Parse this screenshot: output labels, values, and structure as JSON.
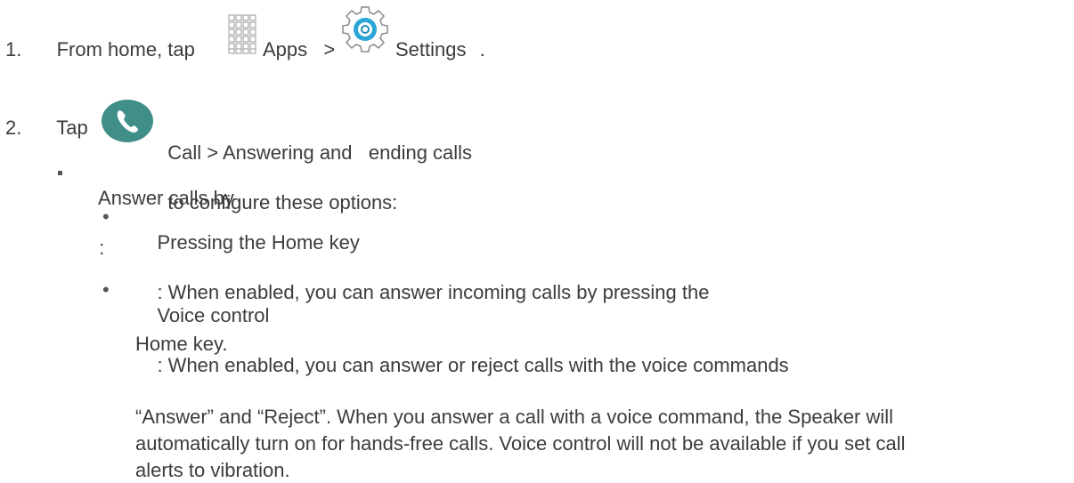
{
  "step1": {
    "number": "1.",
    "lead": "From home, tap",
    "apps_label": "Apps",
    "sep": ">",
    "settings_label": "Settings",
    "end": "."
  },
  "step2": {
    "number": "2.",
    "lead": "Tap",
    "path": "Call > Answering and   ending calls",
    "tail": "to configure these options:"
  },
  "option": {
    "label": "Answer calls by",
    "colon": ":"
  },
  "subitems": [
    {
      "term": "Pressing the Home key",
      "line1": ": When enabled, you can answer incoming calls by pressing the",
      "line2": "Home key."
    },
    {
      "term": "Voice control",
      "line1": ": When enabled, you can answer or reject calls with the voice commands",
      "line2": "“Answer” and “Reject”. When you answer a call with a voice command, the Speaker will",
      "line3": "automatically turn on for hands-free calls. Voice control will not be available if you set call",
      "line4": "alerts to vibration."
    }
  ],
  "icons": {
    "apps": "apps-grid-icon",
    "settings": "settings-gear-icon",
    "call": "phone-call-icon"
  },
  "colors": {
    "text": "#3c3c3c",
    "call_icon": "#3f8f88",
    "settings_accent": "#2aa7d6",
    "grid": "#9a9a9a"
  }
}
